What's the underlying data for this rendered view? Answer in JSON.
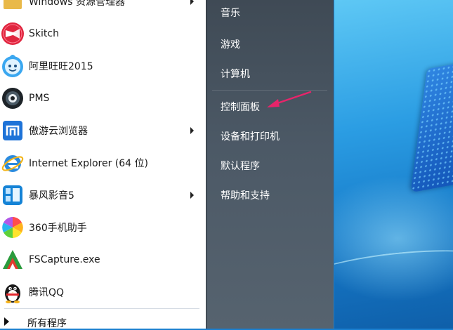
{
  "programs": [
    {
      "label": "Windows 资源管理器",
      "icon": "explorer-folder-icon",
      "has_submenu": true
    },
    {
      "label": "Skitch",
      "icon": "skitch-icon",
      "has_submenu": false
    },
    {
      "label": "阿里旺旺2015",
      "icon": "aliwangwang-icon",
      "has_submenu": false
    },
    {
      "label": "PMS",
      "icon": "pms-icon",
      "has_submenu": false
    },
    {
      "label": "傲游云浏览器",
      "icon": "maxthon-icon",
      "has_submenu": true
    },
    {
      "label": "Internet Explorer (64 位)",
      "icon": "internet-explorer-icon",
      "has_submenu": false
    },
    {
      "label": "暴风影音5",
      "icon": "baofeng-icon",
      "has_submenu": true
    },
    {
      "label": "360手机助手",
      "icon": "360-assistant-icon",
      "has_submenu": false
    },
    {
      "label": "FSCapture.exe",
      "icon": "fscapture-icon",
      "has_submenu": false
    },
    {
      "label": "腾讯QQ",
      "icon": "qq-penguin-icon",
      "has_submenu": false
    }
  ],
  "all_programs_label": "所有程序",
  "system_items": [
    {
      "label": "音乐"
    },
    {
      "label": "游戏"
    },
    {
      "label": "计算机"
    },
    {
      "label": "控制面板"
    },
    {
      "label": "设备和打印机"
    },
    {
      "label": "默认程序"
    },
    {
      "label": "帮助和支持"
    }
  ],
  "colors": {
    "right_pane": "#4c5966",
    "annotation_arrow": "#e8246a",
    "desktop": "#1a7fcf"
  }
}
